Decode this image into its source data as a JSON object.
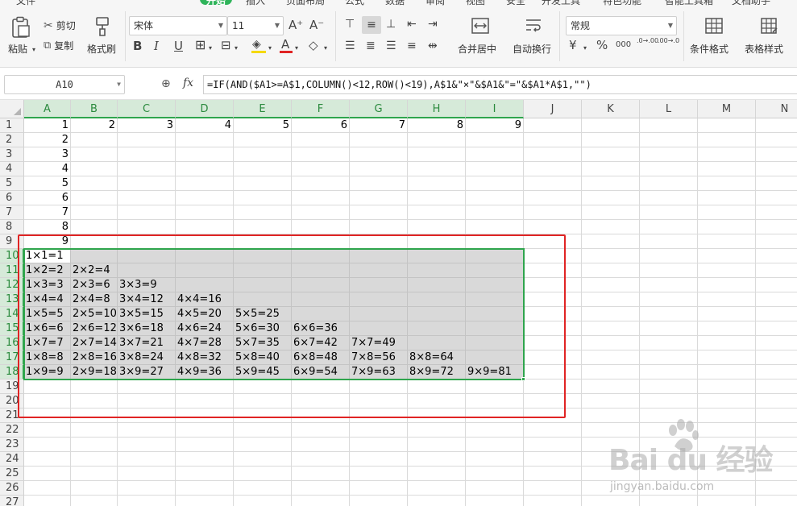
{
  "ribbon": {
    "tabs": [
      "文件",
      "开始",
      "插入",
      "页面布局",
      "公式",
      "数据",
      "审阅",
      "视图",
      "安全",
      "开发工具",
      "特色功能",
      "智能工具箱",
      "文档助手"
    ],
    "active_tab": "开始",
    "paste_label": "粘贴",
    "cut_label": "剪切",
    "copy_label": "复制",
    "format_painter_label": "格式刷",
    "font_name": "宋体",
    "font_size": "11",
    "grow_font": "A⁺",
    "shrink_font": "A⁻",
    "bold": "B",
    "italic": "I",
    "underline": "U",
    "merge_center_label": "合并居中",
    "wrap_text_label": "自动换行",
    "number_format": "常规",
    "percent": "%",
    "thousands": "000",
    "inc_decimal": ".0→.00",
    "dec_decimal": ".00→.0",
    "cond_format_label": "条件格式",
    "table_style_label": "表格样式"
  },
  "formula_bar": {
    "name_box": "A10",
    "fx": "fx",
    "formula": "=IF(AND($A1>=A$1,COLUMN()<12,ROW()<19),A$1&\"×\"&$A1&\"=\"&$A1*A$1,\"\")"
  },
  "sheet": {
    "columns": [
      "A",
      "B",
      "C",
      "D",
      "E",
      "F",
      "G",
      "H",
      "I",
      "J",
      "K",
      "L",
      "M",
      "N"
    ],
    "rows": [
      "1",
      "2",
      "3",
      "4",
      "5",
      "6",
      "7",
      "8",
      "9",
      "10",
      "11",
      "12",
      "13",
      "14",
      "15",
      "16",
      "17",
      "18",
      "19",
      "20",
      "21",
      "22",
      "23",
      "24",
      "25",
      "26",
      "27"
    ],
    "row1": [
      "1",
      "2",
      "3",
      "4",
      "5",
      "6",
      "7",
      "8",
      "9"
    ],
    "colA_numbers": [
      "2",
      "3",
      "4",
      "5",
      "6",
      "7",
      "8",
      "9"
    ],
    "table": [
      [
        "1×1=1"
      ],
      [
        "1×2=2",
        "2×2=4"
      ],
      [
        "1×3=3",
        "2×3=6",
        "3×3=9"
      ],
      [
        "1×4=4",
        "2×4=8",
        "3×4=12",
        "4×4=16"
      ],
      [
        "1×5=5",
        "2×5=10",
        "3×5=15",
        "4×5=20",
        "5×5=25"
      ],
      [
        "1×6=6",
        "2×6=12",
        "3×6=18",
        "4×6=24",
        "5×6=30",
        "6×6=36"
      ],
      [
        "1×7=7",
        "2×7=14",
        "3×7=21",
        "4×7=28",
        "5×7=35",
        "6×7=42",
        "7×7=49"
      ],
      [
        "1×8=8",
        "2×8=16",
        "3×8=24",
        "4×8=32",
        "5×8=40",
        "6×8=48",
        "7×8=56",
        "8×8=64"
      ],
      [
        "1×9=9",
        "2×9=18",
        "3×9=27",
        "4×9=36",
        "5×9=45",
        "6×9=54",
        "7×9=63",
        "8×9=72",
        "9×9=81"
      ]
    ]
  },
  "watermark": {
    "brand": "Bai du 经验",
    "sub": "jingyan.baidu.com"
  },
  "colors": {
    "accent_green": "#2fa54d",
    "highlight_red": "#e02424",
    "selection_gray": "#d9d9d9"
  }
}
